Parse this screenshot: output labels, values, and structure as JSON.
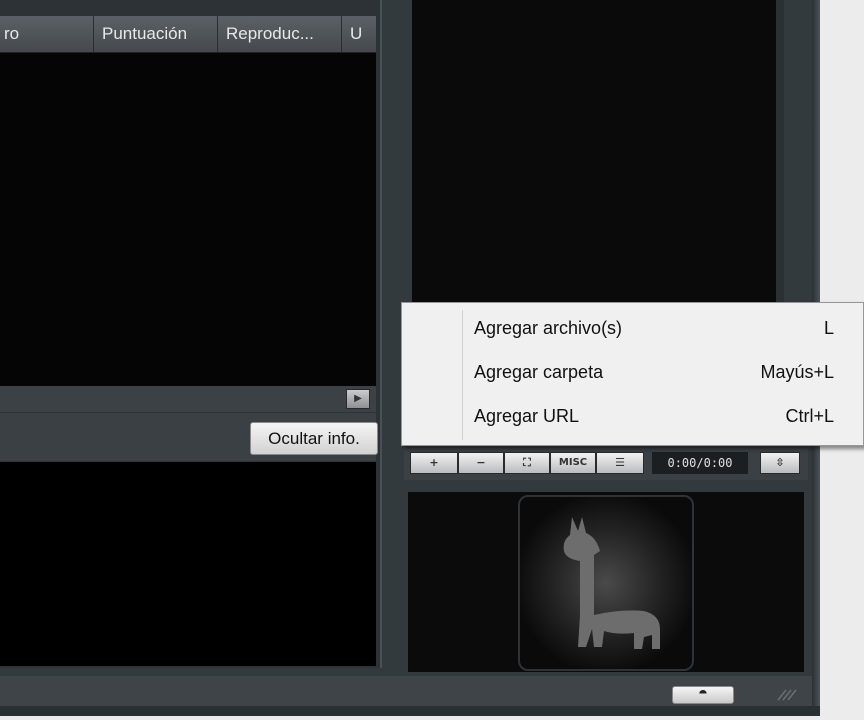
{
  "playlist": {
    "columns": [
      {
        "label": "ro"
      },
      {
        "label": "Puntuación"
      },
      {
        "label": "Reproduc..."
      },
      {
        "label": "U"
      }
    ]
  },
  "info": {
    "hide_button": "Ocultar info."
  },
  "controls": {
    "add": "+",
    "remove": "−",
    "select": "⛶",
    "misc": "MISC",
    "playlist": "☰",
    "time": "0:00/0:00",
    "sort": "⇳"
  },
  "context_menu": {
    "items": [
      {
        "label": "Agregar archivo(s)",
        "shortcut": "L"
      },
      {
        "label": "Agregar carpeta",
        "shortcut": "Mayús+L"
      },
      {
        "label": "Agregar URL",
        "shortcut": "Ctrl+L"
      }
    ]
  },
  "colors": {
    "frame": "#333a3d",
    "menu_bg": "#f0f0f0",
    "video_bg": "#0a0a0a"
  }
}
